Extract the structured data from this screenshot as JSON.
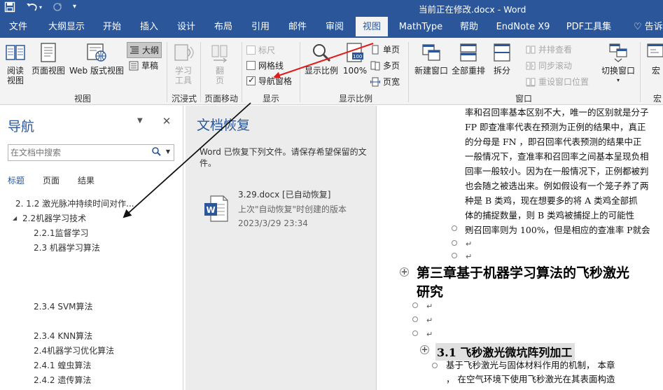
{
  "titlebar": {
    "doc_title": "当前正在修改.docx  -  Word",
    "save_icon": "save-icon",
    "undo_icon": "undo-icon",
    "redo_icon": "redo-icon",
    "customize_icon": "customize-qat-icon"
  },
  "tabs": [
    "文件",
    "大纲显示",
    "开始",
    "插入",
    "设计",
    "布局",
    "引用",
    "邮件",
    "审阅",
    "视图",
    "MathType",
    "帮助",
    "EndNote X9",
    "PDF工具集"
  ],
  "active_tab": "视图",
  "tell_me": "♡ 告诉我",
  "ribbon": {
    "views": {
      "label": "视图",
      "read_mode": "阅读\n视图",
      "print_layout": "页面视图",
      "web_layout": "Web 版式视图",
      "outline": "大纲",
      "draft": "草稿"
    },
    "immersive": {
      "label": "沉浸式",
      "learning_tools": "学习\n工具"
    },
    "page_movement": {
      "label": "页面移动",
      "side_to_side": "翻\n页"
    },
    "show": {
      "label": "显示",
      "ruler": "标尺",
      "gridlines": "网格线",
      "nav_pane": "导航窗格",
      "ruler_checked": false,
      "gridlines_checked": false,
      "nav_pane_checked": true
    },
    "zoom": {
      "label": "显示比例",
      "zoom": "显示比例",
      "hundred": "100%",
      "one_page": "单页",
      "multi_page": "多页",
      "page_width": "页宽"
    },
    "window": {
      "label": "窗口",
      "new_window": "新建窗口",
      "arrange_all": "全部重排",
      "split": "拆分",
      "side_by_side": "并排查看",
      "sync_scroll": "同步滚动",
      "reset_pos": "重设窗口位置",
      "switch_window": "切换窗口"
    },
    "macros": {
      "label": "宏",
      "macros": "宏"
    }
  },
  "nav": {
    "title": "导航",
    "search_placeholder": "在文档中搜索",
    "tabs": [
      "标题",
      "页面",
      "结果"
    ],
    "items": [
      "2. 1.2    激光脉冲持续时间对作...",
      "2.2机器学习技术",
      "2.2.1监督学习",
      "2.3 机器学习算法",
      "2.3.4 SVM算法",
      "2.3.4 KNN算法",
      "2.4机器学习优化算法",
      "2.4.1 蝗虫算法",
      "2.4.2 遗传算法"
    ]
  },
  "recovery": {
    "title": "文档恢复",
    "description": "Word 已恢复下列文件。请保存希望保留的文件。",
    "file_name": "3.29.docx  [已自动恢复]",
    "file_sub": "上次\"自动恢复\"时创建的版本",
    "file_date": "2023/3/29 23:34"
  },
  "document": {
    "lines": [
      "率和召回率基本区别不大，唯一的区别就是分子",
      "FP 即查准率代表在预测为正例的结果中，真正",
      "的分母是  FN  ，即召回率代表预测的结果中正",
      "一般情况下，查准率和召回率之间基本呈现负相",
      "回率一般较小。因为在一般情况下，正例都被判",
      "也会随之被选出来。例如假设有一个笼子养了两",
      "种是  B  类鸡，现在想要多的将  A  类鸡全部抓",
      "体的捕捉数量，则  B  类鸡被捕捉上的可能性",
      "则召回率则为  100%，但是相应的查准率  P就会"
    ],
    "chapter_heading_1": "第三章基于机器学习算法的飞秒激光",
    "chapter_heading_2": "研究",
    "section_heading": "3.1  飞秒激光微坑阵列加工",
    "body_1": "基于飞秒激光与固体材料作用的机制，  本章",
    "body_2": "，  在空气环境下使用飞秒激光在其表面构造",
    "para_mark": "↵"
  },
  "annotation_color": "#e01b1b",
  "arrow_color": "#111111",
  "accent": "#2b579a"
}
